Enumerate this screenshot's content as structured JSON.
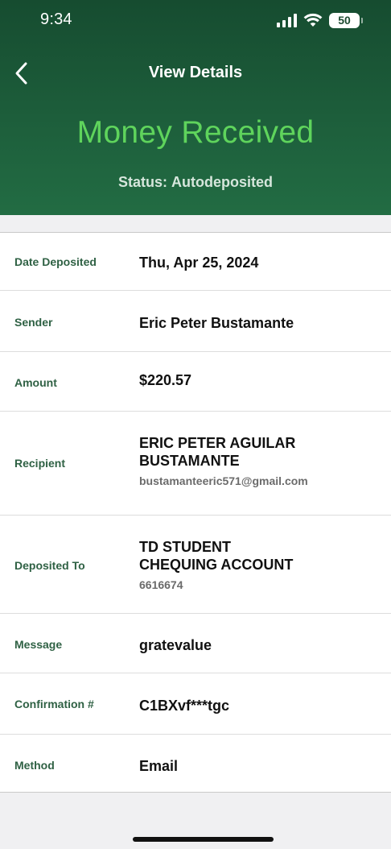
{
  "status_bar": {
    "time": "9:34",
    "battery_level": "50",
    "icons": [
      "signal-icon",
      "wifi-icon",
      "battery-icon"
    ]
  },
  "nav": {
    "back_icon": "chevron-left-icon",
    "title": "View Details"
  },
  "hero": {
    "title": "Money Received",
    "status_label": "Status:",
    "status_value": "Autodeposited",
    "title_color": "#5fd45c",
    "header_color": "#1d5e3b"
  },
  "details": [
    {
      "label": "Date Deposited",
      "value": "Thu, Apr 25, 2024"
    },
    {
      "label": "Sender",
      "value": "Eric Peter Bustamante"
    },
    {
      "label": "Amount",
      "value": "$220.57"
    },
    {
      "label": "Recipient",
      "value_line1": "ERIC PETER AGUILAR",
      "value_line2": "BUSTAMANTE",
      "sub": "bustamanteeric571@gmail.com"
    },
    {
      "label": "Deposited To",
      "value_line1": "TD STUDENT",
      "value_line2": "CHEQUING ACCOUNT",
      "sub": "6616674"
    },
    {
      "label": "Message",
      "value": "gratevalue"
    },
    {
      "label": "Confirmation #",
      "value": "C1BXvf***tgc"
    },
    {
      "label": "Method",
      "value": "Email"
    }
  ]
}
